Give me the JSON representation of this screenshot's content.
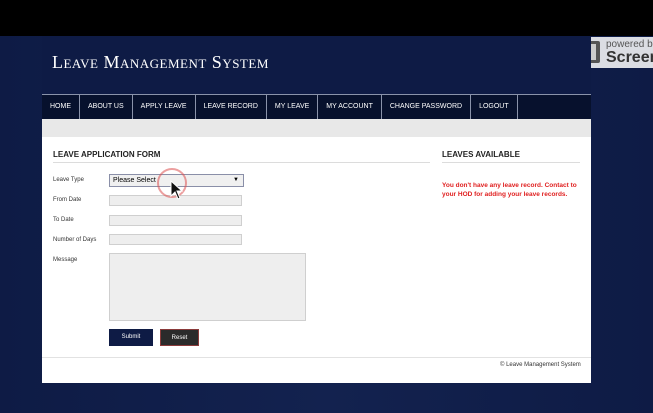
{
  "watermark": {
    "line1": "powered b",
    "line2": "Screen"
  },
  "site": {
    "title": "Leave Management System"
  },
  "nav": {
    "items": [
      {
        "label": "HOME"
      },
      {
        "label": "ABOUT US"
      },
      {
        "label": "APPLY LEAVE"
      },
      {
        "label": "LEAVE RECORD"
      },
      {
        "label": "MY LEAVE"
      },
      {
        "label": "MY ACCOUNT"
      },
      {
        "label": "CHANGE PASSWORD"
      },
      {
        "label": "LOGOUT"
      }
    ]
  },
  "form": {
    "title": "LEAVE APPLICATION FORM",
    "leave_type_label": "Leave Type",
    "leave_type_value": "Please Select",
    "from_date_label": "From Date",
    "to_date_label": "To Date",
    "days_label": "Number of Days",
    "message_label": "Message",
    "submit_label": "Submit",
    "reset_label": "Reset"
  },
  "available": {
    "title": "LEAVES AVAILABLE",
    "message": "You don't have any leave record. Contact to your HOD for adding your leave records."
  },
  "footer": {
    "text": "© Leave Management System"
  },
  "colors": {
    "navy": "#0e1b45",
    "alert": "#e02020"
  }
}
